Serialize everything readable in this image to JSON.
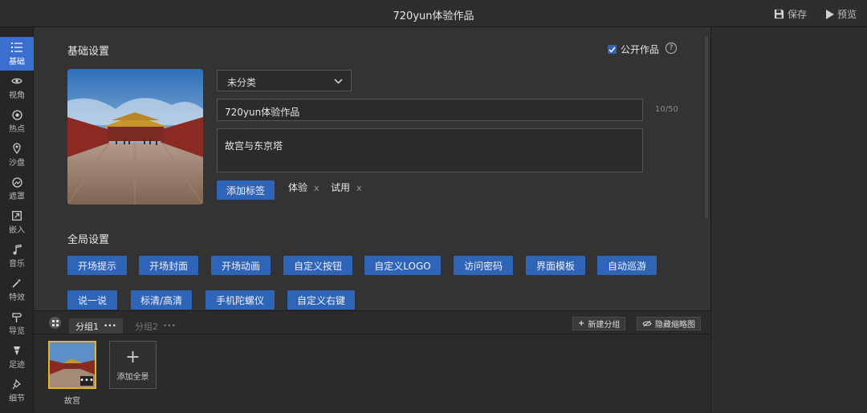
{
  "header": {
    "title": "720yun体验作品",
    "save_label": "保存",
    "preview_label": "预览"
  },
  "sidebar": {
    "items": [
      {
        "label": "基础",
        "icon": "list-icon",
        "active": true
      },
      {
        "label": "视角",
        "icon": "eye-icon"
      },
      {
        "label": "热点",
        "icon": "target-icon"
      },
      {
        "label": "沙盘",
        "icon": "map-pin-icon"
      },
      {
        "label": "遮罩",
        "icon": "mask-icon"
      },
      {
        "label": "嵌入",
        "icon": "embed-icon"
      },
      {
        "label": "音乐",
        "icon": "music-icon"
      },
      {
        "label": "特效",
        "icon": "magic-wand-icon"
      },
      {
        "label": "导览",
        "icon": "signpost-icon"
      },
      {
        "label": "足迹",
        "icon": "footprint-icon"
      },
      {
        "label": "细节",
        "icon": "pin-icon"
      }
    ]
  },
  "basic": {
    "title": "基础设置",
    "public_label": "公开作品",
    "public_checked": true,
    "category_value": "未分类",
    "title_value": "720yun体验作品",
    "title_counter": "10/50",
    "description_value": "故宫与东京塔",
    "add_tag_label": "添加标签",
    "tags": [
      "体验",
      "试用"
    ],
    "tag_remove": "x"
  },
  "global": {
    "title": "全局设置",
    "row1": [
      "开场提示",
      "开场封面",
      "开场动画",
      "自定义按钮",
      "自定义LOGO",
      "访问密码",
      "界面模板",
      "自动巡游"
    ],
    "row2": [
      "说一说",
      "标清/高清",
      "手机陀螺仪",
      "自定义右键"
    ]
  },
  "bottom": {
    "groups": [
      {
        "label": "分组1",
        "dots": "•••",
        "active": true
      },
      {
        "label": "分组2",
        "dots": "•••",
        "active": false
      }
    ],
    "new_group_label": "新建分组",
    "hide_thumbs_label": "隐藏缩略图",
    "scene_label": "故宫",
    "scene_dots": "•••",
    "add_pano_label": "添加全景"
  },
  "colors": {
    "accent": "#2f65b8",
    "selected_border": "#e3b32c"
  }
}
